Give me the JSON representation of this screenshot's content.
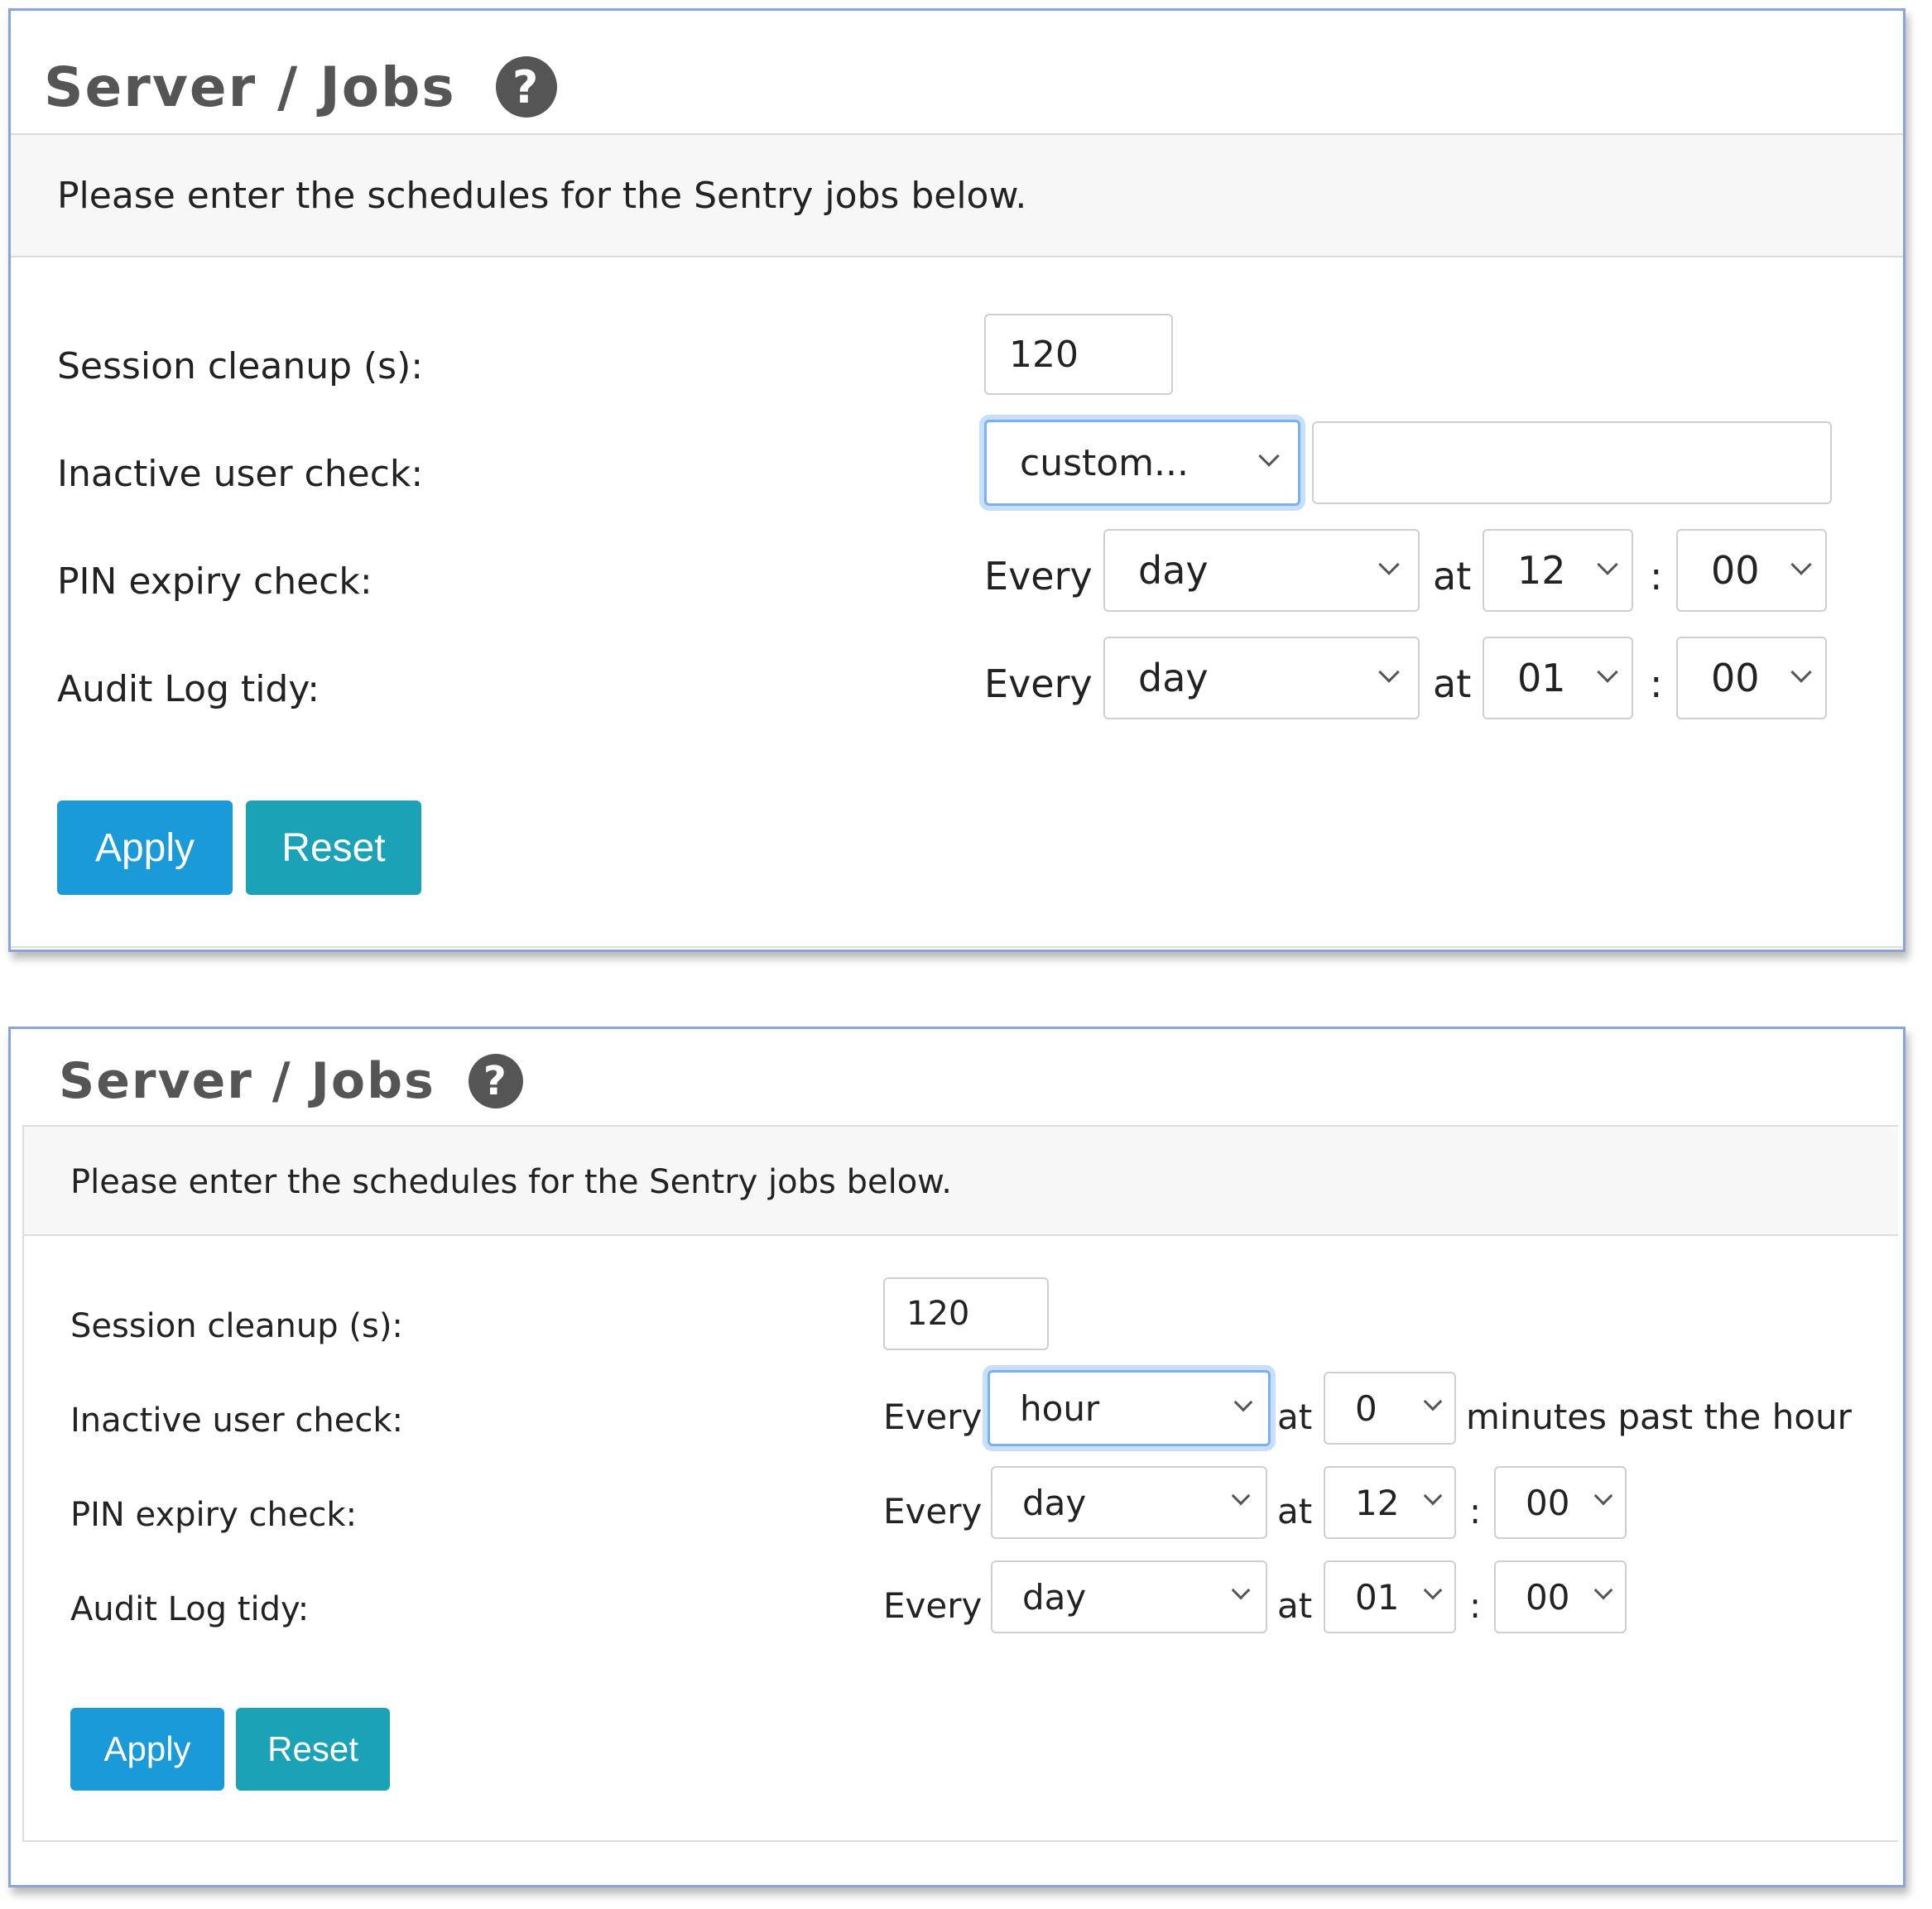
{
  "colors": {
    "apply_button": "#1a9ad9",
    "reset_button": "#1ba2b6",
    "title_text": "#555555",
    "focus_ring": "#7ab0f0",
    "screenshot_border": "#8aa4d8"
  },
  "icons": {
    "help": "question-circle-icon",
    "dropdown": "chevron-down-icon"
  },
  "top": {
    "title": "Server / Jobs",
    "help_glyph": "?",
    "description": "Please enter the schedules for the Sentry jobs below.",
    "session": {
      "label": "Session cleanup (s):",
      "value": "120"
    },
    "inactive": {
      "label": "Inactive user check:",
      "selected": "custom...",
      "custom_value": ""
    },
    "pin": {
      "label": "PIN expiry check:",
      "every": "Every",
      "period": "day",
      "at": "at",
      "hour": "12",
      "colon": ":",
      "minute": "00"
    },
    "audit": {
      "label": "Audit Log tidy:",
      "every": "Every",
      "period": "day",
      "at": "at",
      "hour": "01",
      "colon": ":",
      "minute": "00"
    },
    "apply": "Apply",
    "reset": "Reset"
  },
  "bottom": {
    "title": "Server / Jobs",
    "help_glyph": "?",
    "description": "Please enter the schedules for the Sentry jobs below.",
    "session": {
      "label": "Session cleanup (s):",
      "value": "120"
    },
    "inactive": {
      "label": "Inactive user check:",
      "every": "Every",
      "period": "hour",
      "at": "at",
      "minute": "0",
      "suffix": "minutes past the hour"
    },
    "pin": {
      "label": "PIN expiry check:",
      "every": "Every",
      "period": "day",
      "at": "at",
      "hour": "12",
      "colon": ":",
      "minute": "00"
    },
    "audit": {
      "label": "Audit Log tidy:",
      "every": "Every",
      "period": "day",
      "at": "at",
      "hour": "01",
      "colon": ":",
      "minute": "00"
    },
    "apply": "Apply",
    "reset": "Reset"
  }
}
